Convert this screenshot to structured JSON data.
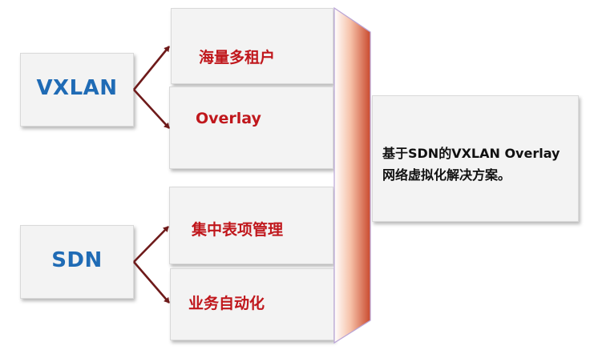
{
  "sources": [
    {
      "label": "VXLAN"
    },
    {
      "label": "SDN"
    }
  ],
  "items": [
    {
      "label": "海量多租户"
    },
    {
      "label": "Overlay"
    },
    {
      "label": "集中表项管理"
    },
    {
      "label": "业务自动化"
    }
  ],
  "result": {
    "line1": "基于SDN的VXLAN Overlay",
    "line2": "网络虚拟化解决方案。"
  },
  "colors": {
    "source_text": "#1f6bb5",
    "item_text": "#c0171c",
    "arrow": "#6e1a1a",
    "panel_gradient": [
      "#ffffff",
      "#f6c1a8",
      "#c94a2e"
    ]
  }
}
